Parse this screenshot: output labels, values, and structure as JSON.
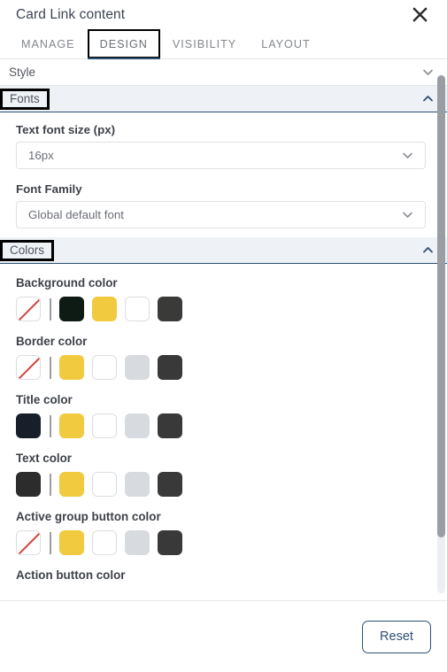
{
  "header": {
    "title": "Card Link content",
    "close_icon": "close-icon"
  },
  "tabs": [
    {
      "label": "MANAGE",
      "active": false,
      "highlighted": false
    },
    {
      "label": "DESIGN",
      "active": true,
      "highlighted": true
    },
    {
      "label": "VISIBILITY",
      "active": false,
      "highlighted": false
    },
    {
      "label": "LAYOUT",
      "active": false,
      "highlighted": false
    }
  ],
  "sections": {
    "style": {
      "label": "Style",
      "expanded": false,
      "chevron": "chevron-down-icon"
    },
    "fonts": {
      "label": "Fonts",
      "expanded": true,
      "chevron": "chevron-up-icon",
      "highlighted": true
    },
    "colors": {
      "label": "Colors",
      "expanded": true,
      "chevron": "chevron-up-icon",
      "highlighted": true
    }
  },
  "fonts": {
    "text_font_size": {
      "label": "Text font size (px)",
      "value": "16px",
      "chevron": "chevron-down-icon"
    },
    "font_family": {
      "label": "Font Family",
      "value": "Global default font",
      "chevron": "chevron-down-icon"
    }
  },
  "colors": {
    "accent_yellow": "#f2ca3f",
    "groups": [
      {
        "label": "Background color",
        "swatches": [
          {
            "name": "no-color",
            "type": "none",
            "color": ""
          },
          {
            "name": "divider",
            "type": "divider",
            "color": ""
          },
          {
            "name": "dark-green",
            "type": "solid",
            "color": "#0e1a14"
          },
          {
            "name": "yellow",
            "type": "solid",
            "color": "#f2ca3f"
          },
          {
            "name": "white",
            "type": "outline",
            "color": "#ffffff"
          },
          {
            "name": "dark-gray",
            "type": "solid",
            "color": "#3a3a39"
          }
        ]
      },
      {
        "label": "Border color",
        "swatches": [
          {
            "name": "no-color",
            "type": "none",
            "color": ""
          },
          {
            "name": "divider",
            "type": "divider",
            "color": ""
          },
          {
            "name": "yellow",
            "type": "solid",
            "color": "#f2ca3f"
          },
          {
            "name": "white",
            "type": "outline",
            "color": "#ffffff"
          },
          {
            "name": "light-gray",
            "type": "solid",
            "color": "#d7dade"
          },
          {
            "name": "dark-gray",
            "type": "solid",
            "color": "#39393a"
          }
        ]
      },
      {
        "label": "Title color",
        "swatches": [
          {
            "name": "dark-navy",
            "type": "solid",
            "color": "#181f2b"
          },
          {
            "name": "divider",
            "type": "divider",
            "color": ""
          },
          {
            "name": "yellow",
            "type": "solid",
            "color": "#f2ca3f"
          },
          {
            "name": "white",
            "type": "outline",
            "color": "#ffffff"
          },
          {
            "name": "light-gray",
            "type": "solid",
            "color": "#d7dade"
          },
          {
            "name": "dark-gray",
            "type": "solid",
            "color": "#39393a"
          }
        ]
      },
      {
        "label": "Text color",
        "swatches": [
          {
            "name": "charcoal",
            "type": "solid",
            "color": "#2c2c2d"
          },
          {
            "name": "divider",
            "type": "divider",
            "color": ""
          },
          {
            "name": "yellow",
            "type": "solid",
            "color": "#f2ca3f"
          },
          {
            "name": "white",
            "type": "outline",
            "color": "#ffffff"
          },
          {
            "name": "light-gray",
            "type": "solid",
            "color": "#d7dade"
          },
          {
            "name": "dark-gray",
            "type": "solid",
            "color": "#39393a"
          }
        ]
      },
      {
        "label": "Active group button color",
        "swatches": [
          {
            "name": "no-color",
            "type": "none",
            "color": ""
          },
          {
            "name": "divider",
            "type": "divider",
            "color": ""
          },
          {
            "name": "yellow",
            "type": "solid",
            "color": "#f2ca3f"
          },
          {
            "name": "white",
            "type": "outline",
            "color": "#ffffff"
          },
          {
            "name": "light-gray",
            "type": "solid",
            "color": "#d7dade"
          },
          {
            "name": "dark-gray",
            "type": "solid",
            "color": "#39393a"
          }
        ]
      },
      {
        "label": "Action button color",
        "swatches": []
      }
    ]
  },
  "footer": {
    "reset_label": "Reset"
  },
  "scrollbar": {
    "name": "vertical-scrollbar"
  }
}
